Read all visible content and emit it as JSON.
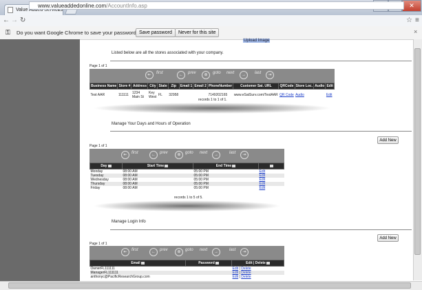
{
  "browser": {
    "tab_title": "Value Added Services",
    "url_prefix": "www.valueaddedonline.com",
    "url_path": "/AccountInfo.asp",
    "infobar_text": "Do you want Google Chrome to save your password?",
    "save_password": "Save password",
    "never_for_site": "Never for this site"
  },
  "page": {
    "upload_image": "Upload Image",
    "stores_intro": "Listed below are all the stores associated with your company.",
    "pager": {
      "first": "first",
      "prev": "prev",
      "goto": "goto",
      "next": "next",
      "last": "last"
    },
    "stores": {
      "page_of": "Page 1 of 1",
      "columns": [
        "Business Name",
        "Store #",
        "Address",
        "City",
        "State",
        "Zip",
        "Email 1",
        "Email 2",
        "PhoneNumber",
        "Customer Sat. URL",
        "QRCode",
        "Store Loc.",
        "Audio",
        "Edit"
      ],
      "row": {
        "business_name": "Test AAR",
        "store": "111111",
        "address": "1234 Main St",
        "city": "Key West",
        "state": "FL",
        "zip": "32958",
        "email1": "",
        "email2": "",
        "phone": "7149202165",
        "url": "www.eSatSurv.com/TestAAR",
        "qrcode": "QR Code",
        "store_loc": "Audio",
        "audio": "",
        "edit": "Edit"
      },
      "records": "records 1 to 1 of 1."
    },
    "hours": {
      "section_title": "Manage Your Days and Hours of Operation",
      "add_new": "Add New",
      "page_of": "Page 1 of 1",
      "columns": [
        "Day",
        "Start Time",
        "End Time",
        ""
      ],
      "rows": [
        {
          "day": "Monday",
          "start": "08:00 AM",
          "end": "05:00 PM",
          "edit": "Edit"
        },
        {
          "day": "Tuesday",
          "start": "08:00 AM",
          "end": "05:00 PM",
          "edit": "Edit"
        },
        {
          "day": "Wednesday",
          "start": "08:00 AM",
          "end": "05:00 PM",
          "edit": "Edit"
        },
        {
          "day": "Thursday",
          "start": "08:00 AM",
          "end": "05:00 PM",
          "edit": "Edit"
        },
        {
          "day": "Friday",
          "start": "08:00 AM",
          "end": "05:00 PM",
          "edit": "Edit"
        }
      ],
      "records": "records 1 to 5 of 5."
    },
    "logins": {
      "section_title": "Manage Login Info",
      "add_new": "Add New",
      "page_of": "Page 1 of 1",
      "columns": [
        "Email",
        "Password",
        "Edit | Delete"
      ],
      "rows": [
        {
          "email": "OwnerFL111111",
          "password": "",
          "edit": "Edit",
          "delete": "Delete"
        },
        {
          "email": "ManagerFL111111",
          "password": "",
          "edit": "Edit",
          "delete": "Delete"
        },
        {
          "email": "anthonyc@PacificResearchGroup.com",
          "password": "",
          "edit": "Edit",
          "delete": "Delete"
        }
      ]
    }
  }
}
